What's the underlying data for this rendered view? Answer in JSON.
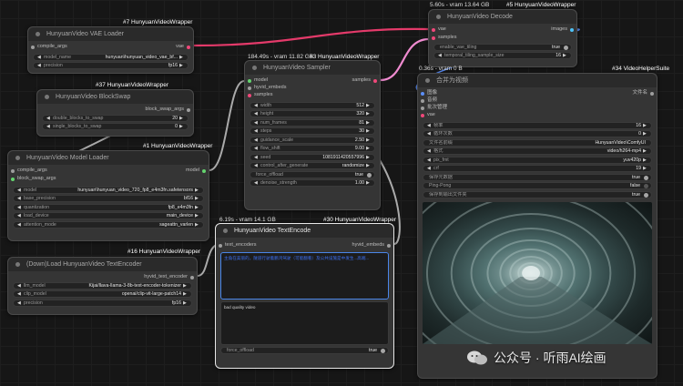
{
  "badges": {
    "vae_loader": "#7 HunyuanVideoWrapper",
    "blockswap": "#37 HunyuanVideoWrapper",
    "model_loader": "#1 HunyuanVideoWrapper",
    "text_encoder_loader": "#16 HunyuanVideoWrapper",
    "sampler": "#3 HunyuanVideoWrapper",
    "text_encode": "#30 HunyuanVideoWrapper",
    "decode": "#5 HunyuanVideoWrapper",
    "combine": "#34 VideoHelperSuite"
  },
  "status": {
    "sampler": "184.49s - vram 11.82 GB",
    "text_encode": "6.19s - vram 14.1 GB",
    "decode": "5.60s - vram 13.64 GB",
    "combine": "0.36s - vram 0 B"
  },
  "vae_loader": {
    "title": "HunyuanVideo VAE Loader",
    "input_compile_args": "compile_args",
    "output_vae": "vae",
    "model_name_label": "model_name",
    "model_name_value": "hunyuan\\hunyuan_video_vae_bf...",
    "precision_label": "precision",
    "precision_value": "fp16"
  },
  "blockswap": {
    "title": "HunyuanVideo BlockSwap",
    "output": "block_swap_args",
    "double_label": "double_blocks_to_swap",
    "double_value": "20",
    "single_label": "single_blocks_to_swap",
    "single_value": "0"
  },
  "model_loader": {
    "title": "HunyuanVideo Model Loader",
    "input_compile": "compile_args",
    "input_block_swap": "block_swap_args",
    "output_model": "model",
    "model_label": "model",
    "model_value": "hunyuan\\hunyuan_video_720_fp8_e4m3fn.safetensors",
    "base_precision_label": "base_precision",
    "base_precision_value": "bf16",
    "quantization_label": "quantization",
    "quantization_value": "fp8_e4m3fn",
    "load_device_label": "load_device",
    "load_device_value": "main_device",
    "attention_label": "attention_mode",
    "attention_value": "sageattn_varlen"
  },
  "text_encoder_loader": {
    "title": "(Down)Load HunyuanVideo TextEncoder",
    "output": "hyvid_text_encoder",
    "llm_label": "llm_model",
    "llm_value": "Kijai/llava-llama-3-8b-text-encoder-tokenizer",
    "clip_label": "clip_model",
    "clip_value": "openai/clip-vit-large-patch14",
    "precision_label": "precision",
    "precision_value": "fp16"
  },
  "sampler": {
    "title": "HunyuanVideo Sampler",
    "input_model": "model",
    "input_embeds": "hyvid_embeds",
    "input_samples": "samples",
    "output_samples": "samples",
    "widgets": [
      {
        "label": "width",
        "value": "512"
      },
      {
        "label": "height",
        "value": "320"
      },
      {
        "label": "num_frames",
        "value": "81"
      },
      {
        "label": "steps",
        "value": "30"
      },
      {
        "label": "guidance_scale",
        "value": "2.50"
      },
      {
        "label": "flow_shift",
        "value": "9.00"
      },
      {
        "label": "seed",
        "value": "1081911420557996"
      },
      {
        "label": "control_after_generate",
        "value": "randomize"
      }
    ],
    "force_offload_label": "force_offload",
    "force_offload_value": "true",
    "denoise_label": "denoise_strength",
    "denoise_value": "1.00"
  },
  "text_encode": {
    "title": "HunyuanVideo TextEncode",
    "input_encoders": "text_encoders",
    "output_embeds": "hyvid_embeds",
    "prompt": "主角在美丽的，隧道行驶着鹏鸿驾驶（可能翻看）及公共设施是中发生...高端...",
    "negative_prompt": "bad quality video",
    "force_offload_label": "force_offload",
    "force_offload_value": "true"
  },
  "decode": {
    "title": "HunyuanVideo Decode",
    "input_vae": "vae",
    "input_samples": "samples",
    "output_images": "images",
    "tiling_label": "enable_vae_tiling",
    "tiling_value": "true",
    "temporal_label": "temporal_tiling_sample_size",
    "temporal_value": "16"
  },
  "combine": {
    "title": "合并为视频",
    "inputs": [
      "图像",
      "音频",
      "批次管理",
      "vae"
    ],
    "output": "文件名",
    "widgets": [
      {
        "label": "帧率",
        "value": "16"
      },
      {
        "label": "循环次数",
        "value": "0"
      },
      {
        "label": "文件名前缀",
        "value": "HunyuanVideo\\ComfyUI"
      },
      {
        "label": "格式",
        "value": "video/h264-mp4"
      },
      {
        "label": "pix_fmt",
        "value": "yuv420p"
      },
      {
        "label": "crf",
        "value": "19"
      },
      {
        "label": "保存元数据",
        "value": "true"
      },
      {
        "label": "Ping-Pong",
        "value": "false"
      },
      {
        "label": "保存到输出文件夹",
        "value": "true"
      }
    ]
  },
  "watermark": "公众号 · 听雨AI绘画",
  "colors": {
    "background": "#161616",
    "node": "#353535",
    "node_title": "#2a2a2a",
    "wire_pink": "#f0487a",
    "wire_gray": "#9a9a9a",
    "socket_green": "#64d46e",
    "selected_outline": "#e8e8e8"
  }
}
